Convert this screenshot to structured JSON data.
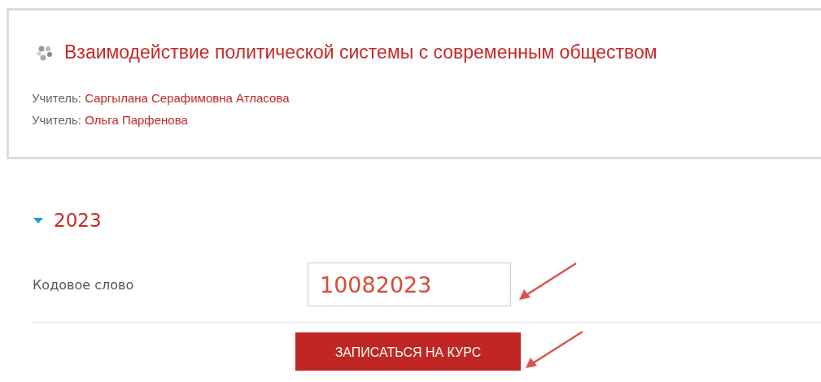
{
  "course": {
    "title": "Взаимодействие политической системы с современным обществом",
    "teachers": [
      {
        "label": "Учитель:",
        "name": "Саргылана Серафимовна Атласова"
      },
      {
        "label": "Учитель:",
        "name": "Ольга Парфенова"
      }
    ]
  },
  "section": {
    "title": "2023",
    "expanded": true
  },
  "form": {
    "label": "Кодовое слово",
    "value": "10082023",
    "button": "ЗАПИСАТЬСЯ НА КУРС"
  },
  "annotations": [
    {
      "kind": "arrow"
    },
    {
      "kind": "arrow"
    }
  ]
}
